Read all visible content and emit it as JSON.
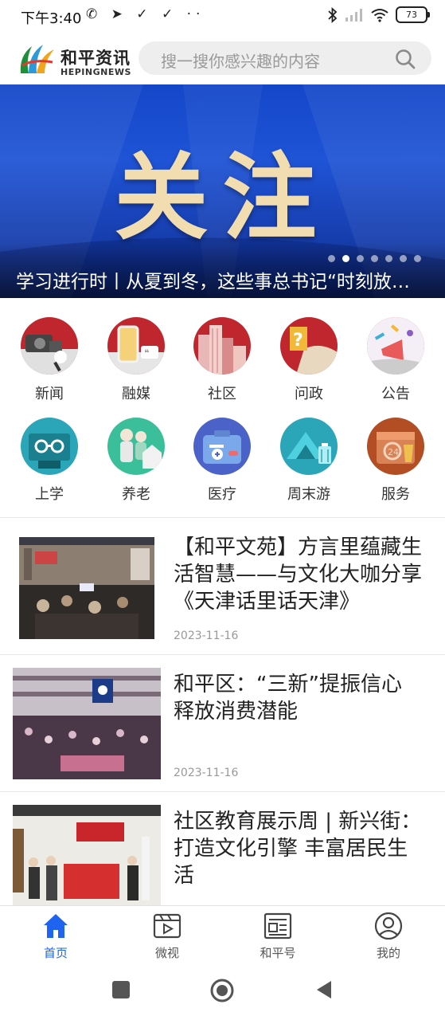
{
  "status_bar": {
    "time": "下午3:40",
    "left_icons": "✆ ➤ ✓ ✓ ··",
    "battery": "73"
  },
  "header": {
    "logo_name": "和平资讯",
    "logo_sub": "HEPINGNEWS",
    "search_placeholder": "搜一搜你感兴趣的内容"
  },
  "banner": {
    "headline": "关注",
    "caption": "学习进行时丨从夏到冬，这些事总书记“时刻放在心上”",
    "dot_count": 7,
    "active_dot": 1
  },
  "categories": [
    {
      "label": "新闻",
      "icon": "camera-mic-icon",
      "color": "#c0262d"
    },
    {
      "label": "融媒",
      "icon": "phone-icon",
      "color": "#c0262d"
    },
    {
      "label": "社区",
      "icon": "buildings-icon",
      "color": "#c0262d"
    },
    {
      "label": "问政",
      "icon": "question-icon",
      "color": "#c0262d"
    },
    {
      "label": "公告",
      "icon": "megaphone-icon",
      "color": "#c0262d"
    },
    {
      "label": "上学",
      "icon": "school-icon",
      "color": "#2aa6b8"
    },
    {
      "label": "养老",
      "icon": "elderly-icon",
      "color": "#2aa6b8"
    },
    {
      "label": "医疗",
      "icon": "medical-kit-icon",
      "color": "#4b63c8"
    },
    {
      "label": "周末游",
      "icon": "travel-icon",
      "color": "#2aa6b8"
    },
    {
      "label": "服务",
      "icon": "service-icon",
      "color": "#b24d24"
    }
  ],
  "news": [
    {
      "title": "【和平文苑】方言里蕴藏生活智慧——与文化大咖分享《天津话里话天津》",
      "date": "2023-11-16"
    },
    {
      "title": "和平区：“三新”提振信心 释放消费潜能",
      "date": "2023-11-16"
    },
    {
      "title": "社区教育展示周 | 新兴街：打造文化引擎 丰富居民生活",
      "date": ""
    }
  ],
  "bottom_nav": [
    {
      "label": "首页",
      "icon": "home-icon",
      "active": true
    },
    {
      "label": "微视",
      "icon": "video-icon",
      "active": false
    },
    {
      "label": "和平号",
      "icon": "article-icon",
      "active": false
    },
    {
      "label": "我的",
      "icon": "profile-icon",
      "active": false
    }
  ],
  "colors": {
    "accent": "#1e64f0",
    "banner_blue": "#1f54d6",
    "headline_gold": "#f1ddb0"
  }
}
